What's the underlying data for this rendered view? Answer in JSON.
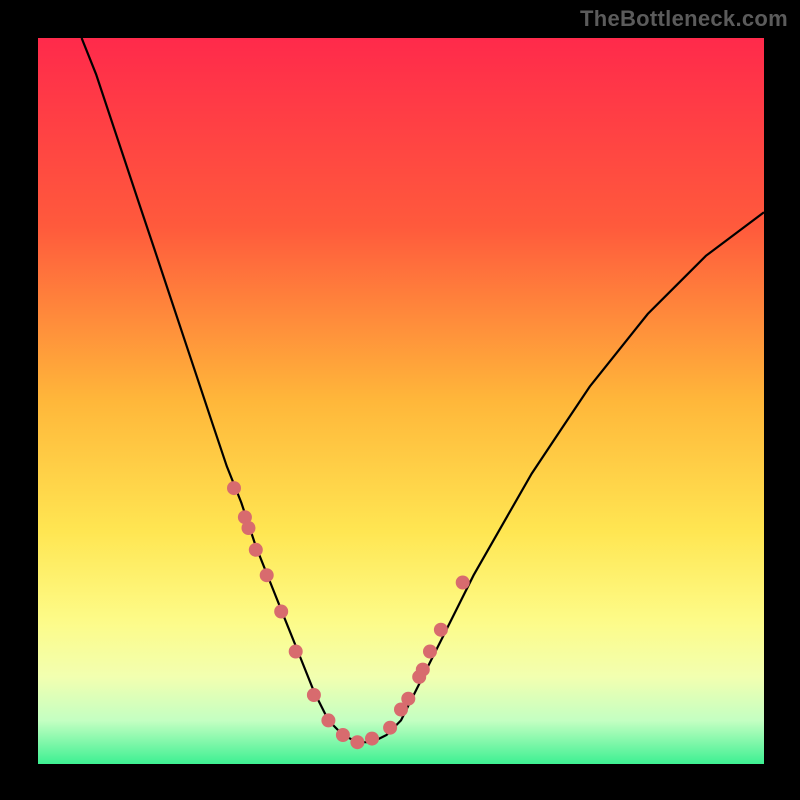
{
  "watermark": "TheBottleneck.com",
  "colors": {
    "black": "#000000",
    "curve": "#000000",
    "dot": "#d86b6e",
    "gradient_stops": [
      {
        "offset": "0%",
        "color": "#ff2a4b"
      },
      {
        "offset": "26%",
        "color": "#ff5a3c"
      },
      {
        "offset": "50%",
        "color": "#ffb73a"
      },
      {
        "offset": "68%",
        "color": "#ffe652"
      },
      {
        "offset": "80%",
        "color": "#fdfb87"
      },
      {
        "offset": "88%",
        "color": "#f2ffb0"
      },
      {
        "offset": "94%",
        "color": "#c4ffc2"
      },
      {
        "offset": "100%",
        "color": "#3df092"
      }
    ]
  },
  "chart_data": {
    "type": "line",
    "title": "",
    "xlabel": "",
    "ylabel": "",
    "x_range": [
      0,
      100
    ],
    "y_range": [
      0,
      100
    ],
    "note": "V-shaped bottleneck curve. x is component balance position (0–100), y is bottleneck severity (0 = none/green at bottom, 100 = max/red at top). Minimum plateau near x≈38–47.",
    "series": [
      {
        "name": "bottleneck-curve",
        "x": [
          6,
          8,
          10,
          12,
          14,
          16,
          18,
          20,
          22,
          24,
          26,
          28,
          30,
          32,
          34,
          36,
          38,
          40,
          42,
          44,
          46,
          48,
          50,
          52,
          54,
          56,
          58,
          60,
          64,
          68,
          72,
          76,
          80,
          84,
          88,
          92,
          96,
          100
        ],
        "y": [
          100,
          95,
          89,
          83,
          77,
          71,
          65,
          59,
          53,
          47,
          41,
          36,
          30,
          25,
          20,
          15,
          10,
          6,
          4,
          3,
          3,
          4,
          6,
          10,
          14,
          18,
          22,
          26,
          33,
          40,
          46,
          52,
          57,
          62,
          66,
          70,
          73,
          76
        ]
      }
    ],
    "highlight_points": {
      "name": "sample-dots",
      "x": [
        27.0,
        28.5,
        29.0,
        30.0,
        31.5,
        33.5,
        35.5,
        38.0,
        40.0,
        42.0,
        44.0,
        46.0,
        48.5,
        50.0,
        51.0,
        52.5,
        53.0,
        54.0,
        55.5,
        58.5
      ],
      "y": [
        38.0,
        34.0,
        32.5,
        29.5,
        26.0,
        21.0,
        15.5,
        9.5,
        6.0,
        4.0,
        3.0,
        3.5,
        5.0,
        7.5,
        9.0,
        12.0,
        13.0,
        15.5,
        18.5,
        25.0
      ],
      "radius": 7
    }
  }
}
